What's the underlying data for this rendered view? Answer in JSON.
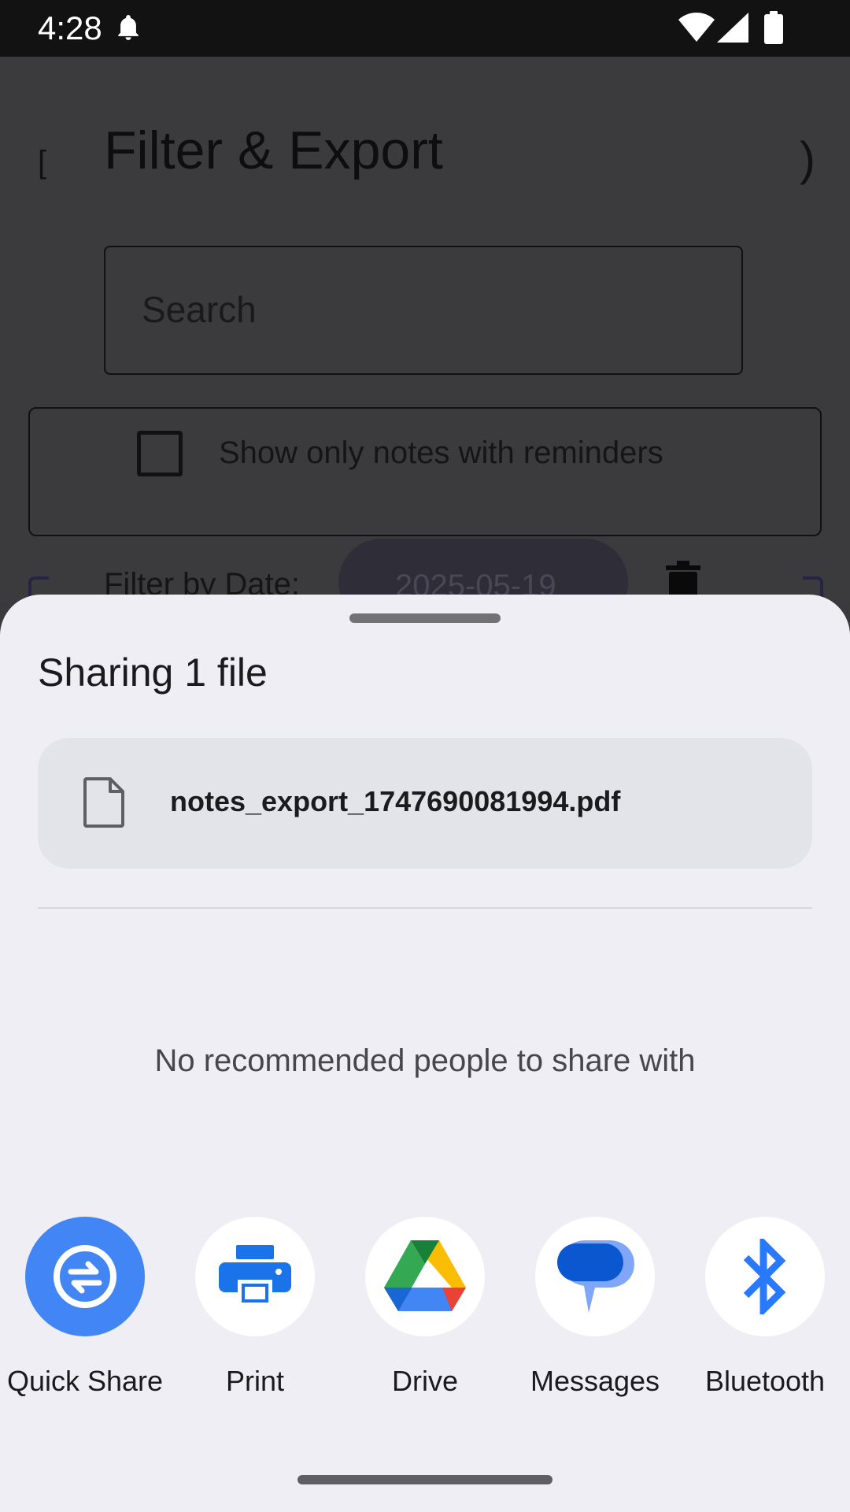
{
  "status_bar": {
    "time": "4:28",
    "icons": [
      "notification-bell-icon",
      "wifi-icon",
      "signal-icon",
      "battery-icon"
    ]
  },
  "background_app": {
    "title": "Filter & Export",
    "search_placeholder": "Search",
    "reminder_checkbox_label": "Show only notes with reminders",
    "reminder_checked": false,
    "date_filter_label": "Filter by Date:",
    "date_value": "2025-05-19"
  },
  "share_sheet": {
    "title": "Sharing 1 file",
    "file_name": "notes_export_1747690081994.pdf",
    "empty_people_message": "No recommended people to share with",
    "apps": [
      {
        "label": "Quick Share",
        "icon": "quick-share-icon"
      },
      {
        "label": "Print",
        "icon": "printer-icon"
      },
      {
        "label": "Drive",
        "icon": "google-drive-icon"
      },
      {
        "label": "Messages",
        "icon": "messages-icon"
      },
      {
        "label": "Bluetooth",
        "icon": "bluetooth-icon"
      }
    ]
  },
  "colors": {
    "sheet_background": "#eeeef4",
    "quick_share_blue": "#4285f4",
    "print_blue": "#1a73e8",
    "bluetooth_blue": "#2979ff",
    "scrim": "#3a3a3c"
  }
}
